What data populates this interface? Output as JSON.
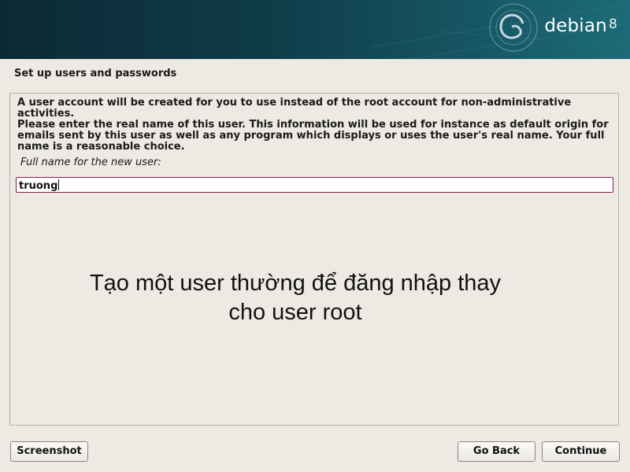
{
  "banner": {
    "brand": "debian",
    "version": "8",
    "logo_icon": "debian-swirl-icon"
  },
  "step_title": "Set up users and passwords",
  "instructions": {
    "intro": "A user account will be created for you to use instead of the root account for non-administrative activities.",
    "details": "Please enter the real name of this user. This information will be used for instance as default origin for emails sent by this user as well as any program which displays or uses the user's real name. Your full name is a reasonable choice."
  },
  "form": {
    "full_name_label": "Full name for the new user:",
    "full_name_value": "truong"
  },
  "overlay_caption": {
    "line1": "Tạo một user thường để đăng nhập thay",
    "line2": "cho user root"
  },
  "buttons": {
    "screenshot": "Screenshot",
    "go_back": "Go Back",
    "continue": "Continue"
  },
  "colors": {
    "banner_dark": "#0b2a35",
    "banner_light": "#1d6b78",
    "background": "#ede9e3",
    "input_border": "#8a1c4a"
  }
}
